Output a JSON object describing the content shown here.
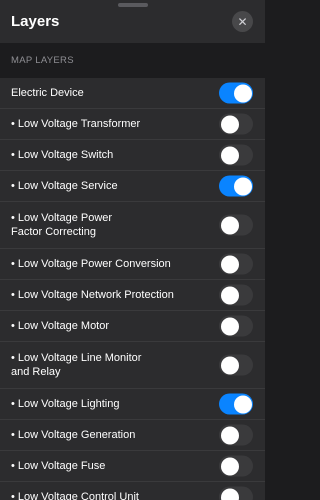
{
  "panel": {
    "title": "Layers",
    "close_icon": "close-icon"
  },
  "section": {
    "header": "MAP LAYERS"
  },
  "layers": [
    {
      "label": "Electric Device",
      "enabled": true
    },
    {
      "label": "• Low Voltage Transformer",
      "enabled": false
    },
    {
      "label": "• Low Voltage Switch",
      "enabled": false
    },
    {
      "label": "• Low Voltage Service",
      "enabled": true
    },
    {
      "label": "• Low Voltage Power\nFactor Correcting",
      "enabled": false
    },
    {
      "label": "• Low Voltage Power Conversion",
      "enabled": false
    },
    {
      "label": "• Low Voltage Network Protection",
      "enabled": false
    },
    {
      "label": "• Low Voltage Motor",
      "enabled": false
    },
    {
      "label": "• Low Voltage Line Monitor\nand Relay",
      "enabled": false
    },
    {
      "label": "• Low Voltage Lighting",
      "enabled": true
    },
    {
      "label": "• Low Voltage Generation",
      "enabled": false
    },
    {
      "label": "• Low Voltage Fuse",
      "enabled": false
    },
    {
      "label": "• Low Voltage Control Unit",
      "enabled": false
    }
  ],
  "colors": {
    "toggle_on": "#0a84ff",
    "toggle_off": "#3a3a3c",
    "background": "#1c1c1e",
    "panel": "#2c2c2e"
  }
}
